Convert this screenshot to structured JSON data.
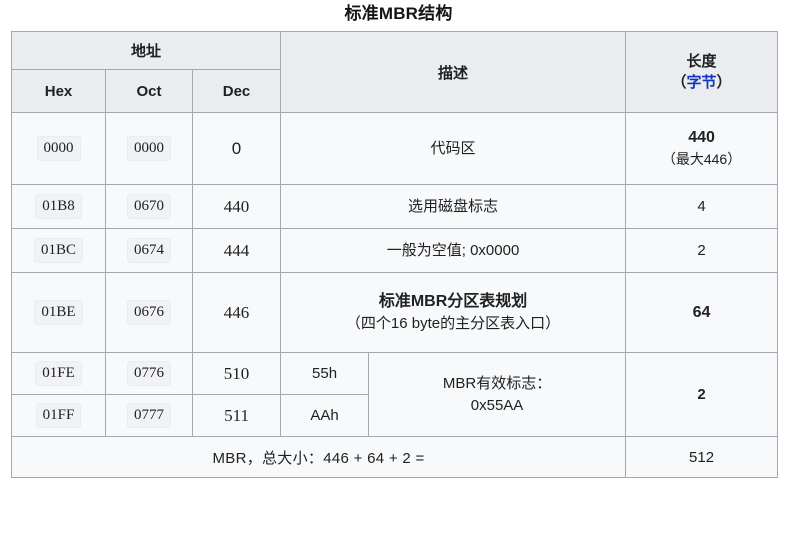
{
  "title": "标准MBR结构",
  "colors": {
    "header_bg": "#eaecf0",
    "cell_bg": "#f8f9fa",
    "border": "#a2a9b1",
    "link_blue": "#0b35a1",
    "unit_blue": "#1034c0",
    "text": "#202122"
  },
  "table": {
    "header": {
      "address_group": "地址",
      "address_cols": [
        "Hex",
        "Oct",
        "Dec"
      ],
      "description": "描述",
      "length_label": "长度",
      "length_paren_open": "（",
      "length_unit": "字节",
      "length_paren_close": "）"
    },
    "rows": [
      {
        "hex": "0000",
        "oct": "0000",
        "dec": "0",
        "desc_main": "代码区",
        "desc_sub": "",
        "len_main": "440",
        "len_note": "（最大446）",
        "len_bold": true,
        "desc_bold": false
      },
      {
        "hex": "01B8",
        "oct": "0670",
        "dec": "440",
        "desc_main": "选用磁盘标志",
        "desc_sub": "",
        "len_main": "4",
        "len_note": "",
        "len_bold": false,
        "desc_bold": false
      },
      {
        "hex": "01BC",
        "oct": "0674",
        "dec": "444",
        "desc_main": "一般为空值; 0x0000",
        "desc_sub": "",
        "len_main": "2",
        "len_note": "",
        "len_bold": false,
        "desc_bold": false
      },
      {
        "hex": "01BE",
        "oct": "0676",
        "dec": "446",
        "desc_main": "标准MBR分区表规划",
        "desc_sub": "（四个16 byte的主分区表入口）",
        "len_main": "64",
        "len_note": "",
        "len_bold": true,
        "desc_bold": true
      }
    ],
    "signature_rows": [
      {
        "hex": "01FE",
        "oct": "0776",
        "dec": "510",
        "sig": "55h"
      },
      {
        "hex": "01FF",
        "oct": "0777",
        "dec": "511",
        "sig": "AAh"
      }
    ],
    "signature_desc_line1": "MBR有效标志：",
    "signature_desc_line2": "0x55AA",
    "signature_length": "2",
    "total": {
      "label": "MBR，总大小：446 + 64 + 2 =",
      "value": "512"
    }
  }
}
